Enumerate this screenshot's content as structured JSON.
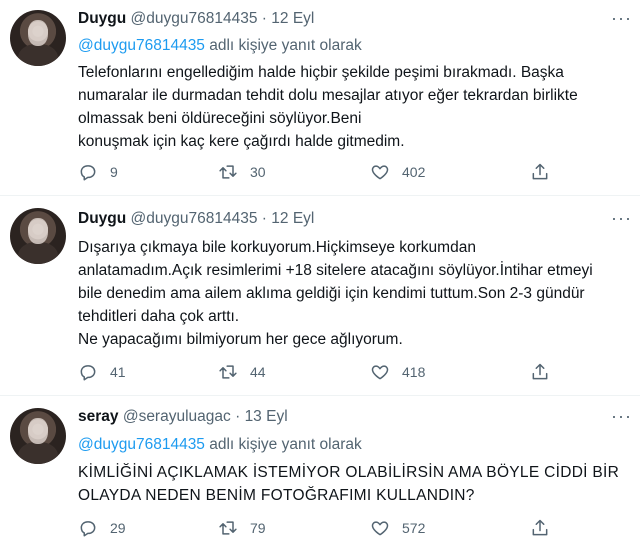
{
  "tweets": [
    {
      "name": "Duygu",
      "handle": "@duygu76814435",
      "date": "12 Eyl",
      "reply_mention": "@duygu76814435",
      "reply_suffix": "adlı kişiye yanıt olarak",
      "lines": [
        "Telefonlarını engellediğim halde hiçbir şekilde peşimi bırakmadı. Başka",
        "numaralar ile durmadan tehdit dolu mesajlar atıyor eğer tekrardan birlikte",
        "olmassak beni öldüreceğini söylüyor.Beni",
        "konuşmak için kaç kere çağırdı halde gitmedim."
      ],
      "replies": "9",
      "retweets": "30",
      "likes": "402"
    },
    {
      "name": "Duygu",
      "handle": "@duygu76814435",
      "date": "12 Eyl",
      "lines": [
        "Dışarıya çıkmaya bile korkuyorum.Hiçkimseye korkumdan",
        "anlatamadım.Açık resimlerimi +18 sitelere atacağını söylüyor.İntihar etmeyi",
        "bile denedim ama ailem aklıma geldiği için kendimi tuttum.Son 2-3 gündür",
        "tehditleri daha çok arttı.",
        "Ne yapacağımı bilmiyorum her gece ağlıyorum."
      ],
      "replies": "41",
      "retweets": "44",
      "likes": "418"
    },
    {
      "name": "seray",
      "handle": "@serayuluagac",
      "date": "13 Eyl",
      "reply_mention": "@duygu76814435",
      "reply_suffix": "adlı kişiye yanıt olarak",
      "lines": [
        "KİMLİĞİNİ AÇIKLAMAK İSTEMİYOR OLABİLİRSİN AMA BÖYLE CİDDİ BİR",
        "OLAYDA NEDEN BENİM FOTOĞRAFIMI KULLANDIN?"
      ],
      "replies": "29",
      "retweets": "79",
      "likes": "572"
    }
  ],
  "separator": "·",
  "more_icon": "more-horizontal-icon"
}
